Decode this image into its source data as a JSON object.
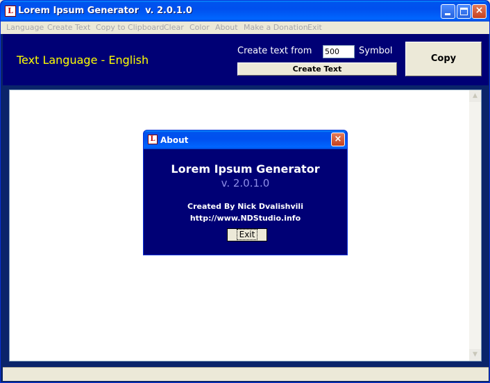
{
  "window": {
    "title": "Lorem Ipsum Generator  v. 2.0.1.0",
    "icon": "L",
    "controls": {
      "minimize": "minimize-icon",
      "maximize": "maximize-icon",
      "close": "×"
    }
  },
  "menu": {
    "items": [
      "Language",
      "Create Text",
      "Copy to Clipboard",
      "Clear",
      "Color",
      "About",
      "Make a Donation",
      "Exit"
    ]
  },
  "toolbar": {
    "language_label": "Text Language - English",
    "create_from_label": "Create text from",
    "symbol_count": "500",
    "symbol_label": "Symbol",
    "create_button": "Create Text",
    "copy_button": "Copy"
  },
  "editor": {
    "content": ""
  },
  "about_dialog": {
    "icon": "L",
    "title": "About",
    "close": "×",
    "app_name": "Lorem Ipsum Generator",
    "version": "v. 2.0.1.0",
    "author": "Created By Nick Dvalishvili",
    "url": "http://www.NDStudio.info",
    "exit_button": "Exit"
  },
  "colors": {
    "panel_bg": "#000075",
    "language_text": "#FFFF00",
    "version_text": "#8F8FE8"
  }
}
